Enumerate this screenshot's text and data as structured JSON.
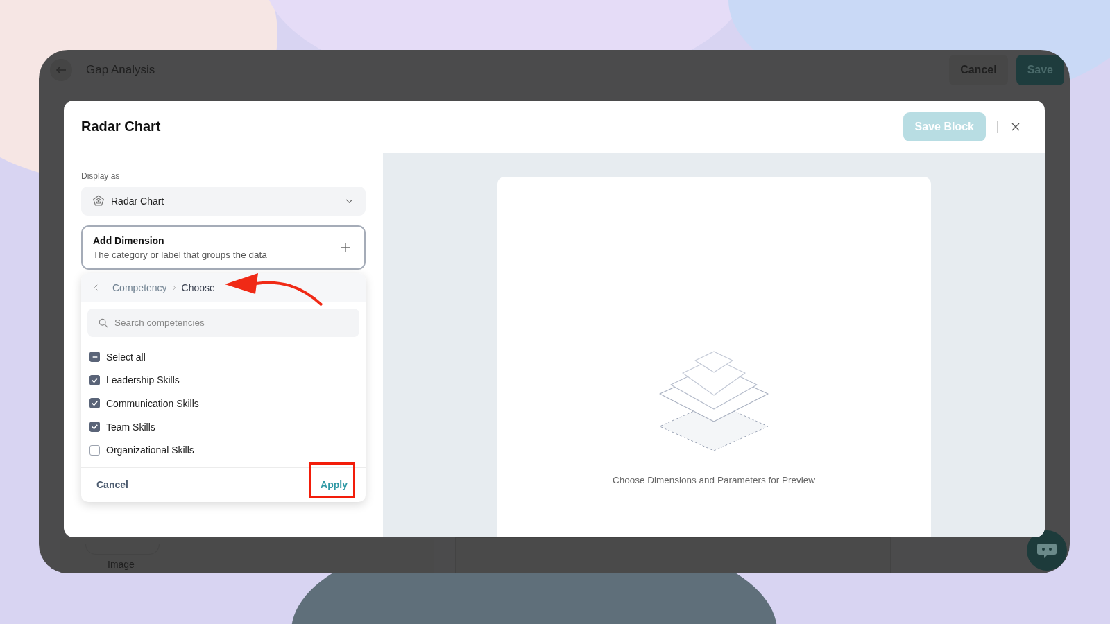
{
  "app": {
    "title": "Gap Analysis",
    "buttons": [
      {
        "label": "Cancel",
        "kind": "secondary"
      },
      {
        "label": "Save",
        "kind": "primary"
      }
    ],
    "background_label": "Image"
  },
  "modal": {
    "title": "Radar Chart",
    "save_button": {
      "label": "Save Block",
      "disabled": true
    },
    "display_as": {
      "label": "Display as",
      "value": "Radar Chart"
    },
    "add_dimension": {
      "title": "Add Dimension",
      "description": "The category or label that groups the data"
    },
    "picker": {
      "breadcrumb": [
        "Competency",
        "Choose"
      ],
      "search": {
        "placeholder": "Search competencies"
      },
      "select_all": {
        "label": "Select all",
        "indeterminate": true
      },
      "options": [
        {
          "label": "Leadership Skills",
          "checked": true
        },
        {
          "label": "Communication Skills",
          "checked": true
        },
        {
          "label": "Team Skills",
          "checked": true
        },
        {
          "label": "Organizational Skills",
          "checked": false
        }
      ],
      "cancel": "Cancel",
      "apply": "Apply"
    },
    "preview": {
      "message": "Choose Dimensions and Parameters for Preview"
    }
  }
}
